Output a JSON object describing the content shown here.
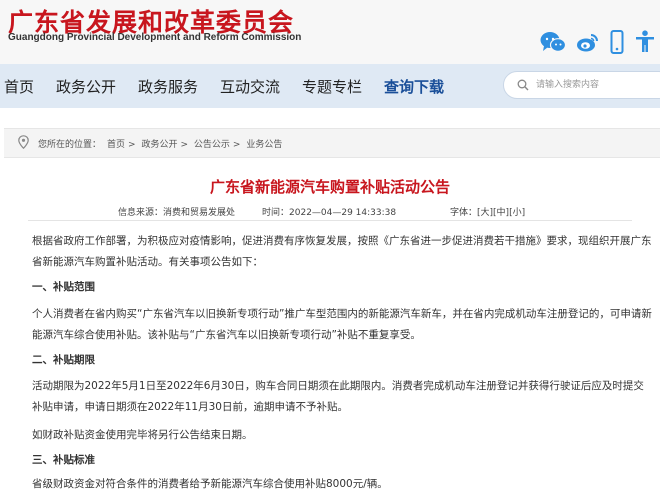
{
  "header": {
    "title": "广东省发展和改革委员会",
    "subtitle": "Guangdong Provincial Development and Reform Commission"
  },
  "top_icons": [
    "wechat-icon",
    "weibo-icon",
    "mobile-icon",
    "accessibility-icon"
  ],
  "nav": {
    "items": [
      "首页",
      "政务公开",
      "政务服务",
      "互动交流",
      "专题专栏",
      "查询下载"
    ],
    "active_index": 5
  },
  "search": {
    "placeholder": "请输入搜索内容"
  },
  "breadcrumb": {
    "label": "您所在的位置：",
    "path": [
      "首页",
      "政务公开",
      "公告公示",
      "业务公告"
    ],
    "separator": ">"
  },
  "article": {
    "title": "广东省新能源汽车购置补贴活动公告",
    "source_label": "信息来源：",
    "source": "消费和贸易发展处",
    "time_label": "时间：",
    "time": "2022—04—29 14:33:38",
    "font_label": "字体：",
    "font_options": [
      "[大]",
      "[中]",
      "[小]"
    ],
    "paragraphs": {
      "intro": "根据省政府工作部署，为积极应对疫情影响，促进消费有序恢复发展，按照《广东省进一步促进消费若干措施》要求，现组织开展广东省新能源汽车购置补贴活动。有关事项公告如下：",
      "s1_heading": "一、补贴范围",
      "s1_text": "个人消费者在省内购买“广东省汽车以旧换新专项行动”推广车型范围内的新能源汽车新车，并在省内完成机动车注册登记的，可申请新能源汽车综合使用补贴。该补贴与“广东省汽车以旧换新专项行动”补贴不重复享受。",
      "s2_heading": "二、补贴期限",
      "s2_text": "活动期限为2022年5月1日至2022年6月30日，购车合同日期须在此期限内。消费者完成机动车注册登记并获得行驶证后应及时提交补贴申请，申请日期须在2022年11月30日前，逾期申请不予补贴。",
      "s2_note": "如财政补贴资金使用完毕将另行公告结束日期。",
      "s3_heading": "三、补贴标准",
      "s3_text": "省级财政资金对符合条件的消费者给予新能源汽车综合使用补贴8000元/辆。"
    }
  },
  "colors": {
    "brand_red": "#c8161e",
    "nav_bg": "#dfe9f4",
    "active_nav": "#1a4f99",
    "icon_blue": "#2f8fe0"
  }
}
